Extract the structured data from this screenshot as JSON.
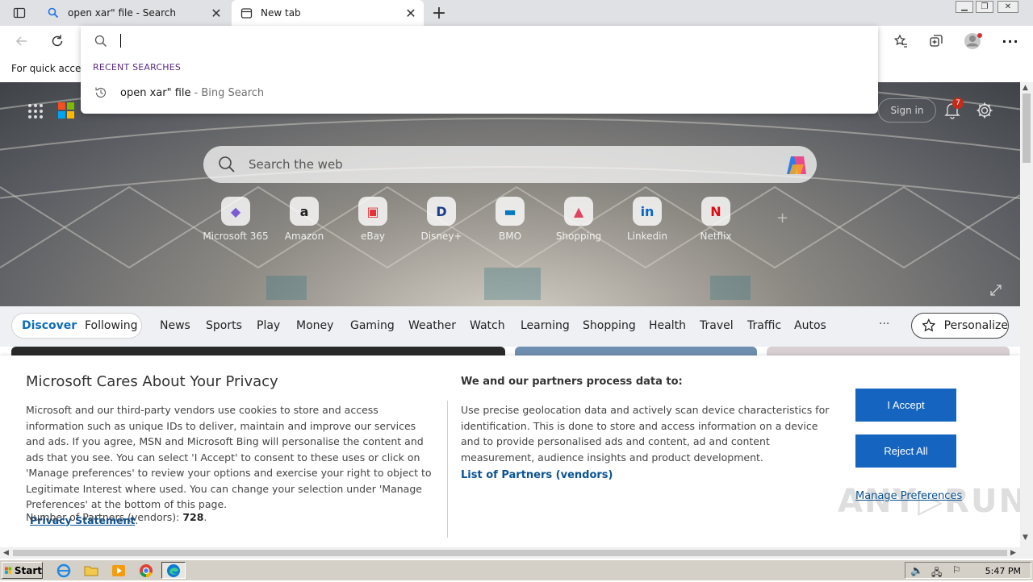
{
  "tabs": [
    {
      "title": "open xar\" file - Search",
      "icon": "search-icon"
    },
    {
      "title": "New tab",
      "icon": "newtab-icon"
    }
  ],
  "favorites_bar": {
    "text": "For quick access"
  },
  "omnibox": {
    "recent_label": "RECENT SEARCHES",
    "suggestion": {
      "query": "open xar\" file",
      "source": "- Bing Search"
    }
  },
  "header": {
    "signin": "Sign in",
    "notifications_count": "7"
  },
  "search": {
    "placeholder": "Search the web"
  },
  "tiles": [
    {
      "label": "Microsoft 365",
      "glyph": "◆",
      "color": "#7b5cd6"
    },
    {
      "label": "Amazon",
      "glyph": "a",
      "color": "#222222"
    },
    {
      "label": "eBay",
      "glyph": "▣",
      "color": "#e53238"
    },
    {
      "label": "Disney+",
      "glyph": "D",
      "color": "#1b3d8c"
    },
    {
      "label": "BMO",
      "glyph": "▬",
      "color": "#0079c1"
    },
    {
      "label": "Shopping",
      "glyph": "▲",
      "color": "#e0445c"
    },
    {
      "label": "Linkedin",
      "glyph": "in",
      "color": "#0a66c2"
    },
    {
      "label": "Netflix",
      "glyph": "N",
      "color": "#e50914"
    }
  ],
  "feed": {
    "discover": "Discover",
    "following": "Following",
    "nav": [
      "News",
      "Sports",
      "Play",
      "Money",
      "Gaming",
      "Weather",
      "Watch",
      "Learning",
      "Shopping",
      "Health",
      "Travel",
      "Traffic",
      "Autos"
    ],
    "more": "···",
    "personalize": "Personalize"
  },
  "privacy": {
    "title": "Microsoft Cares About Your Privacy",
    "body": "Microsoft and our third-party vendors use cookies to store and access information such as unique IDs to deliver, maintain and improve our services and ads. If you agree, MSN and Microsoft Bing will personalise the content and ads that you see. You can select 'I Accept' to consent to these uses or click on 'Manage preferences' to review your options and exercise your right to object to Legitimate Interest where used.  You can change your selection under 'Manage Preferences' at the bottom of this page.",
    "statement_link": "Privacy Statement",
    "partners_label": "Number of Partners (vendors):",
    "partners_count": "728",
    "purposes_title": "We and our partners process data to:",
    "purposes_body": "Use precise geolocation data and actively scan device characteristics for identification. This is done to store and access information on a device and to provide personalised ads and content, ad and content measurement, audience insights and product development.",
    "vendors_link": "List of Partners (vendors)",
    "accept": "I Accept",
    "reject": "Reject All",
    "manage": "Manage Preferences"
  },
  "watermark": "ANY▷RUN",
  "taskbar": {
    "start": "Start",
    "time": "5:47 PM"
  },
  "colors": {
    "accent": "#1565c0",
    "link": "#0b5394",
    "discover": "#0f6cbd"
  }
}
